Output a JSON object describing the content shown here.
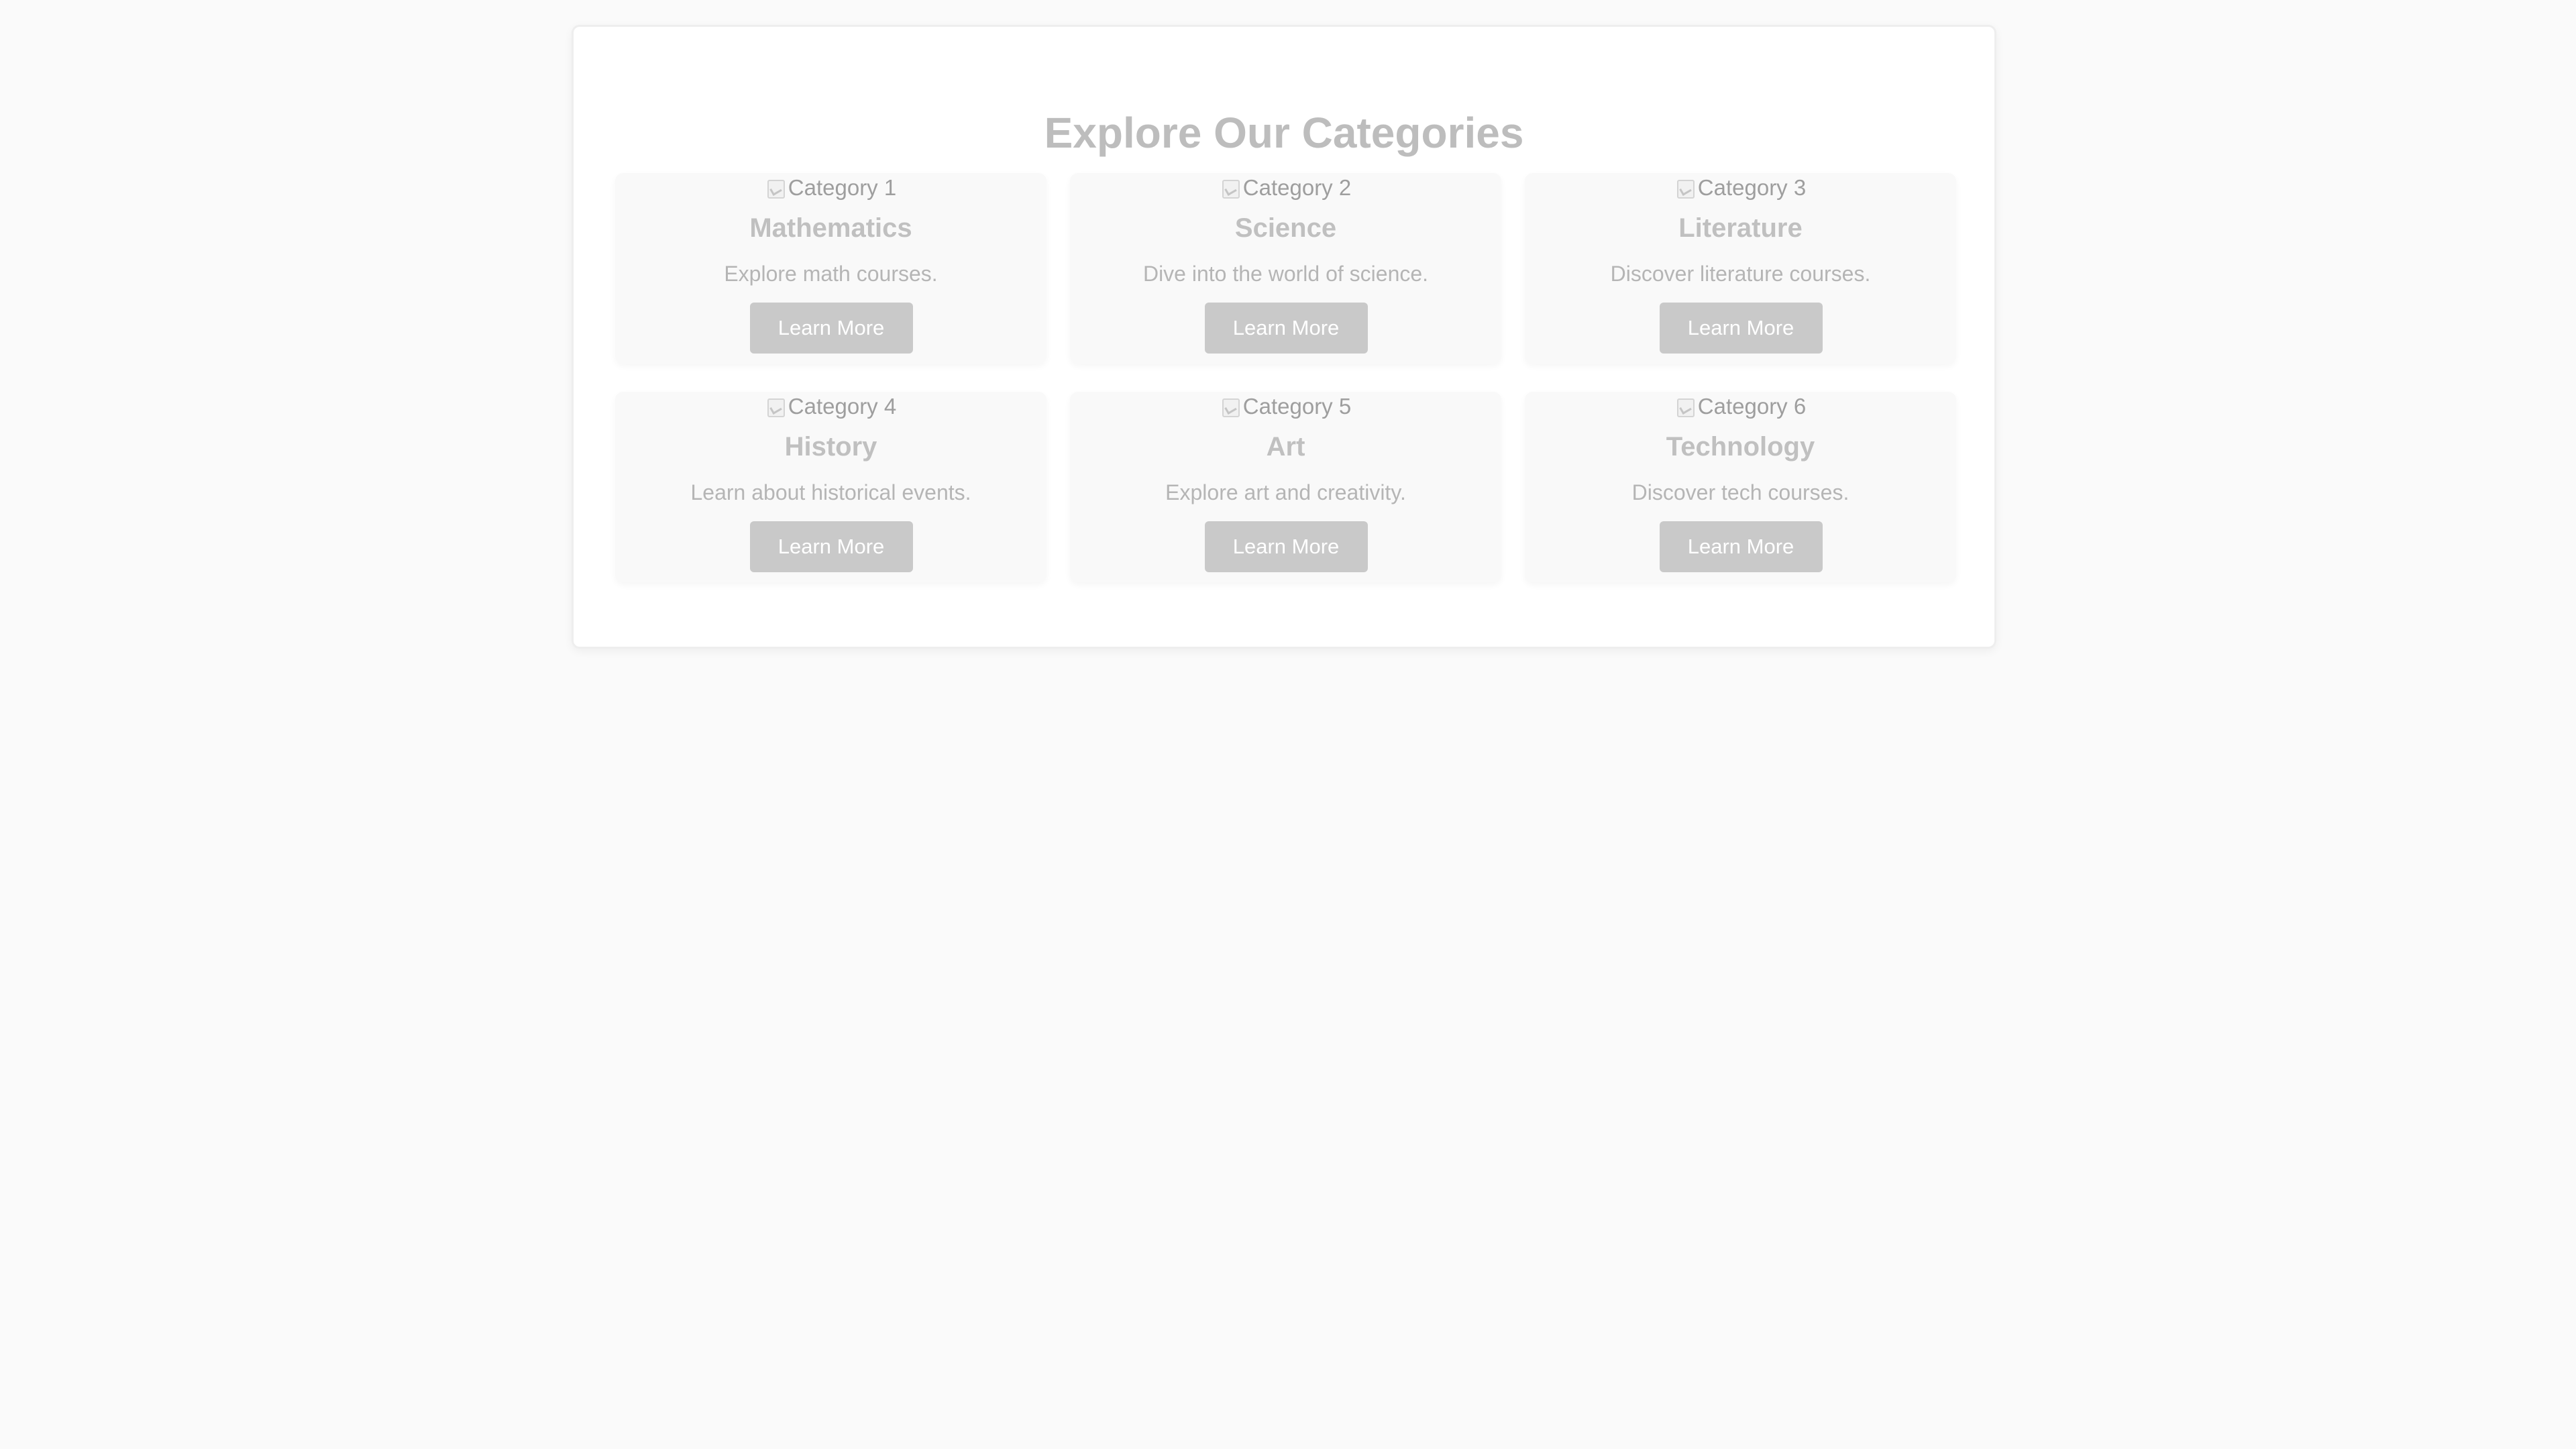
{
  "page": {
    "title": "Explore Our Categories"
  },
  "categories": [
    {
      "image_alt": "Category 1",
      "name": "Mathematics",
      "description": "Explore math courses.",
      "button_label": "Learn More"
    },
    {
      "image_alt": "Category 2",
      "name": "Science",
      "description": "Dive into the world of science.",
      "button_label": "Learn More"
    },
    {
      "image_alt": "Category 3",
      "name": "Literature",
      "description": "Discover literature courses.",
      "button_label": "Learn More"
    },
    {
      "image_alt": "Category 4",
      "name": "History",
      "description": "Learn about historical events.",
      "button_label": "Learn More"
    },
    {
      "image_alt": "Category 5",
      "name": "Art",
      "description": "Explore art and creativity.",
      "button_label": "Learn More"
    },
    {
      "image_alt": "Category 6",
      "name": "Technology",
      "description": "Discover tech courses.",
      "button_label": "Learn More"
    }
  ],
  "colors": {
    "page_background": "#fafafa",
    "panel_background": "#ffffff",
    "card_background": "#f9f9f9",
    "button_background": "#c9c9c9",
    "button_text": "#ffffff",
    "title_text": "#bdbdbd"
  },
  "icons": {
    "image_placeholder": "broken-image-icon"
  }
}
